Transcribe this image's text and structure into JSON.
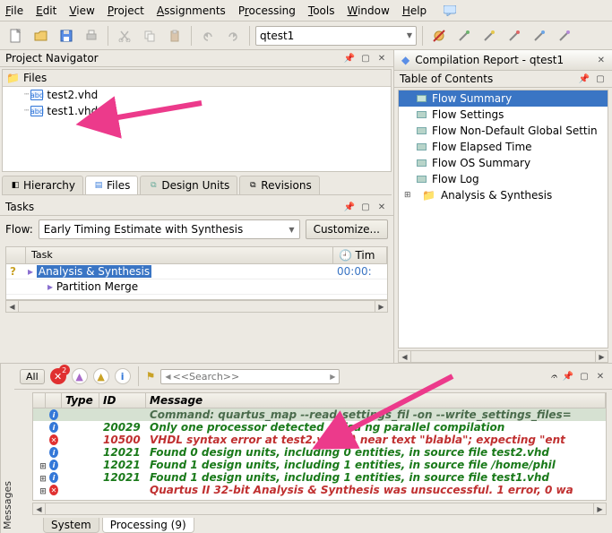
{
  "menus": [
    "File",
    "Edit",
    "View",
    "Project",
    "Assignments",
    "Processing",
    "Tools",
    "Window",
    "Help"
  ],
  "toolbar_project_combo": "qtest1",
  "project_navigator": {
    "title": "Project Navigator",
    "files_label": "Files",
    "files": [
      "test2.vhd",
      "test1.vhd"
    ],
    "tabs": [
      "Hierarchy",
      "Files",
      "Design Units",
      "Revisions"
    ],
    "active_tab": 1
  },
  "tasks": {
    "title": "Tasks",
    "flow_label": "Flow:",
    "flow_value": "Early Timing Estimate with Synthesis",
    "customize_label": "Customize...",
    "columns": [
      "",
      "Task",
      "Tim"
    ],
    "clock_glyph": "🕘",
    "rows": [
      {
        "status": "?",
        "indent": 1,
        "marker": "▸",
        "label": "Analysis & Synthesis",
        "time": "00:00:",
        "selected": true
      },
      {
        "status": "",
        "indent": 2,
        "marker": "▸",
        "label": "Partition Merge",
        "time": ""
      }
    ]
  },
  "compilation_report": {
    "tab_title": "Compilation Report - qtest1",
    "toc_title": "Table of Contents",
    "items": [
      {
        "label": "Flow Summary",
        "selected": true,
        "expander": ""
      },
      {
        "label": "Flow Settings",
        "selected": false,
        "expander": ""
      },
      {
        "label": "Flow Non-Default Global Settin",
        "selected": false,
        "expander": ""
      },
      {
        "label": "Flow Elapsed Time",
        "selected": false,
        "expander": ""
      },
      {
        "label": "Flow OS Summary",
        "selected": false,
        "expander": ""
      },
      {
        "label": "Flow Log",
        "selected": false,
        "expander": ""
      },
      {
        "label": "Analysis & Synthesis",
        "selected": false,
        "expander": "⊞",
        "folder": true
      }
    ]
  },
  "messages": {
    "side_label": "Messages",
    "all_label": "All",
    "error_badge": "2",
    "search_placeholder": "<<Search>>",
    "columns": [
      "Type",
      "ID",
      "Message"
    ],
    "rows": [
      {
        "cls": "cmd",
        "exp": "",
        "icon": "info",
        "id": "",
        "msg": "Command: quartus_map --read_settings_fil  -on --write_settings_files="
      },
      {
        "cls": "info",
        "exp": "",
        "icon": "info",
        "id": "20029",
        "msg": "Only one processor detected - disa    ng parallel compilation"
      },
      {
        "cls": "err",
        "exp": "",
        "icon": "err",
        "id": "10500",
        "msg": "VHDL syntax error at test2.vhd(1) near text \"blabla\";  expecting \"ent"
      },
      {
        "cls": "info",
        "exp": "",
        "icon": "info",
        "id": "12021",
        "msg": "Found 0 design units, including 0 entities, in source file test2.vhd"
      },
      {
        "cls": "info",
        "exp": "⊞",
        "icon": "info",
        "id": "12021",
        "msg": "Found 1 design units, including 1 entities, in source file /home/phil"
      },
      {
        "cls": "info",
        "exp": "⊞",
        "icon": "info",
        "id": "12021",
        "msg": "Found 1 design units, including 1 entities, in source file test1.vhd"
      },
      {
        "cls": "err",
        "exp": "⊞",
        "icon": "err",
        "id": "",
        "msg": "Quartus II 32-bit Analysis & Synthesis was unsuccessful. 1 error, 0 wa"
      }
    ],
    "tabs": [
      "System",
      "Processing (9)"
    ],
    "active_tab": 1
  }
}
